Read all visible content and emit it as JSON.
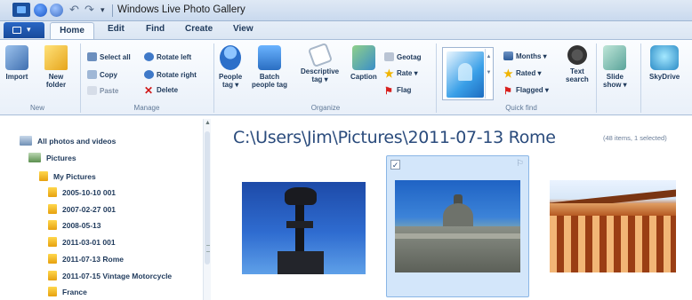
{
  "window": {
    "title": "Windows Live Photo Gallery"
  },
  "quick_access": {
    "icons": [
      "app-icon",
      "circle-icon",
      "circle-icon",
      "undo-icon",
      "redo-icon",
      "dropdown-icon"
    ],
    "undo_glyph": "↶",
    "redo_glyph": "↷",
    "dropdown_glyph": "▾"
  },
  "app_menu": {
    "arrow": "▾"
  },
  "tabs": [
    "Home",
    "Edit",
    "Find",
    "Create",
    "View"
  ],
  "ribbon": {
    "new_group": {
      "label": "New",
      "import": "Import",
      "new_folder_1": "New",
      "new_folder_2": "folder"
    },
    "manage_group": {
      "label": "Manage",
      "select_all": "Select all",
      "copy": "Copy",
      "paste": "Paste",
      "rotate_left": "Rotate left",
      "rotate_right": "Rotate right",
      "delete": "Delete"
    },
    "organize_group": {
      "label": "Organize",
      "people_tag_1": "People",
      "people_tag_2": "tag ▾",
      "batch_1": "Batch",
      "batch_2": "people tag",
      "descriptive_1": "Descriptive",
      "descriptive_2": "tag ▾",
      "caption": "Caption",
      "geotag": "Geotag",
      "rate": "Rate ▾",
      "flag": "Flag"
    },
    "quick_find_group": {
      "label": "Quick find",
      "months": "Months ▾",
      "rated": "Rated ▾",
      "flagged": "Flagged ▾",
      "text_search_1": "Text",
      "text_search_2": "search",
      "scroll_up": "▲",
      "scroll_down": "▼"
    },
    "share_group": {
      "slide_show_1": "Slide",
      "slide_show_2": "show ▾",
      "skydrive": "SkyDrive"
    }
  },
  "nav": {
    "all_photos": "All photos and videos",
    "pictures": "Pictures",
    "my_pictures": "My Pictures",
    "folders": [
      "2005-10-10 001",
      "2007-02-27 001",
      "2008-05-13",
      "2011-03-01 001",
      "2011-07-13 Rome",
      "2011-07-15 Vintage Motorcycle",
      "France"
    ],
    "scroll_up": "▲"
  },
  "content": {
    "path": "C:\\Users\\Jim\\Pictures\\2011-07-13 Rome",
    "count": "(48 items, 1 selected)",
    "check": "✓",
    "flag_glyph": "⚐"
  }
}
